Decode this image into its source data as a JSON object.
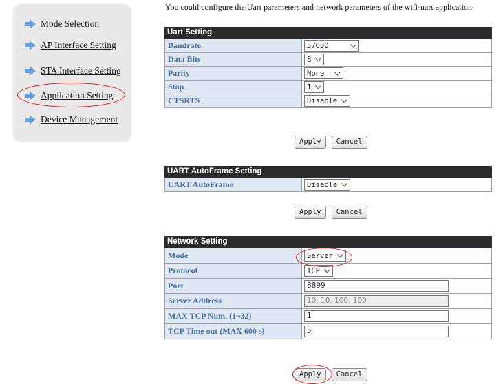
{
  "sidebar": {
    "items": [
      {
        "label": "Mode Selection"
      },
      {
        "label": "AP Interface Setting"
      },
      {
        "label": "STA Interface Setting"
      },
      {
        "label": "Application Setting"
      },
      {
        "label": "Device Management"
      }
    ]
  },
  "intro": "You could configure the Uart parameters and network parameters of the wifi-uart application.",
  "uart": {
    "header": "Uart Setting",
    "rows": [
      {
        "label": "Baudrate",
        "value": "57600"
      },
      {
        "label": "Data Bits",
        "value": "8"
      },
      {
        "label": "Parity",
        "value": "None"
      },
      {
        "label": "Stop",
        "value": "1"
      },
      {
        "label": "CTSRTS",
        "value": "Disable"
      }
    ],
    "apply": "Apply",
    "cancel": "Cancel"
  },
  "autoframe": {
    "header": "UART AutoFrame Setting",
    "rows": [
      {
        "label": "UART AutoFrame",
        "value": "Disable"
      }
    ],
    "apply": "Apply",
    "cancel": "Cancel"
  },
  "network": {
    "header": "Network Setting",
    "mode": {
      "label": "Mode",
      "value": "Server"
    },
    "protocol": {
      "label": "Protocol",
      "value": "TCP"
    },
    "port": {
      "label": "Port",
      "value": "8899"
    },
    "server_address": {
      "label": "Server Address",
      "value": "10. 10. 100. 100"
    },
    "max_tcp": {
      "label": "MAX TCP Num. (1~32)",
      "value": "1"
    },
    "timeout": {
      "label": "TCP Time out (MAX 600 s)",
      "value": "5"
    },
    "apply": "Apply",
    "cancel": "Cancel"
  },
  "colors": {
    "arrow": "#6aa0e0",
    "circle": "#dd1111",
    "header_bg": "#2b2b2b",
    "label_bg": "#dee7f2",
    "label_text": "#4a6fa5"
  }
}
